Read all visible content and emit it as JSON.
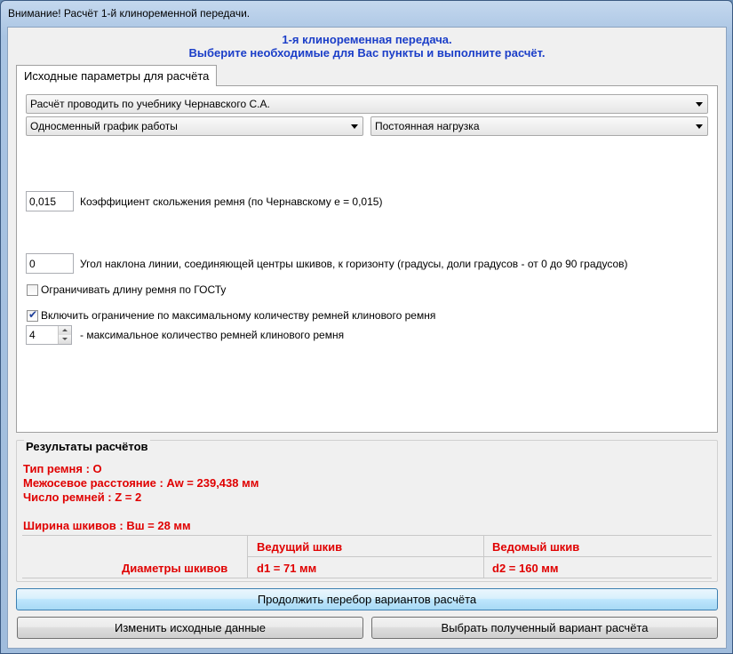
{
  "window": {
    "title": "Внимание! Расчёт 1-й клиноременной передачи."
  },
  "header": {
    "line1": "1-я клиноременная передача.",
    "line2": "Выберите необходимые для Вас пункты и выполните расчёт."
  },
  "tabs": [
    {
      "label": "Исходные параметры для расчёта"
    }
  ],
  "params": {
    "textbook_select": "Расчёт проводить по учебнику Чернавского С.А.",
    "schedule_select": "Односменный график работы",
    "load_select": "Постоянная нагрузка",
    "slip_value": "0,015",
    "slip_label": "Коэффициент скольжения ремня (по Чернавскому е = 0,015)",
    "angle_value": "0",
    "angle_label": "Угол наклона линии, соединяющей центры шкивов, к горизонту (градусы, доли градусов - от 0 до 90 градусов)",
    "gost_checkbox_label": "Ограничивать длину ремня по ГОСТу",
    "gost_checked": false,
    "max_belts_checkbox_label": "Включить ограничение по максимальному количеству ремней клинового ремня",
    "max_belts_checked": true,
    "max_belts_value": "4",
    "max_belts_label": "- максимальное количество ремней клинового ремня"
  },
  "results": {
    "title": "Результаты расчётов",
    "belt_type": "Тип ремня :  О",
    "center_distance": "Межосевое расстояние :  Aw = 239,438 мм",
    "belt_count": "Число ремней :  Z = 2",
    "pulley_width": "Ширина шкивов :  Вш = 28 мм",
    "table": {
      "col_driving": "Ведущий шкив",
      "col_driven": "Ведомый шкив",
      "row_label": "Диаметры шкивов",
      "d1": "d1 = 71 мм",
      "d2": "d2 = 160 мм"
    }
  },
  "buttons": {
    "continue": "Продолжить перебор вариантов расчёта",
    "change_input": "Изменить исходные данные",
    "select_variant": "Выбрать полученный вариант расчёта"
  }
}
